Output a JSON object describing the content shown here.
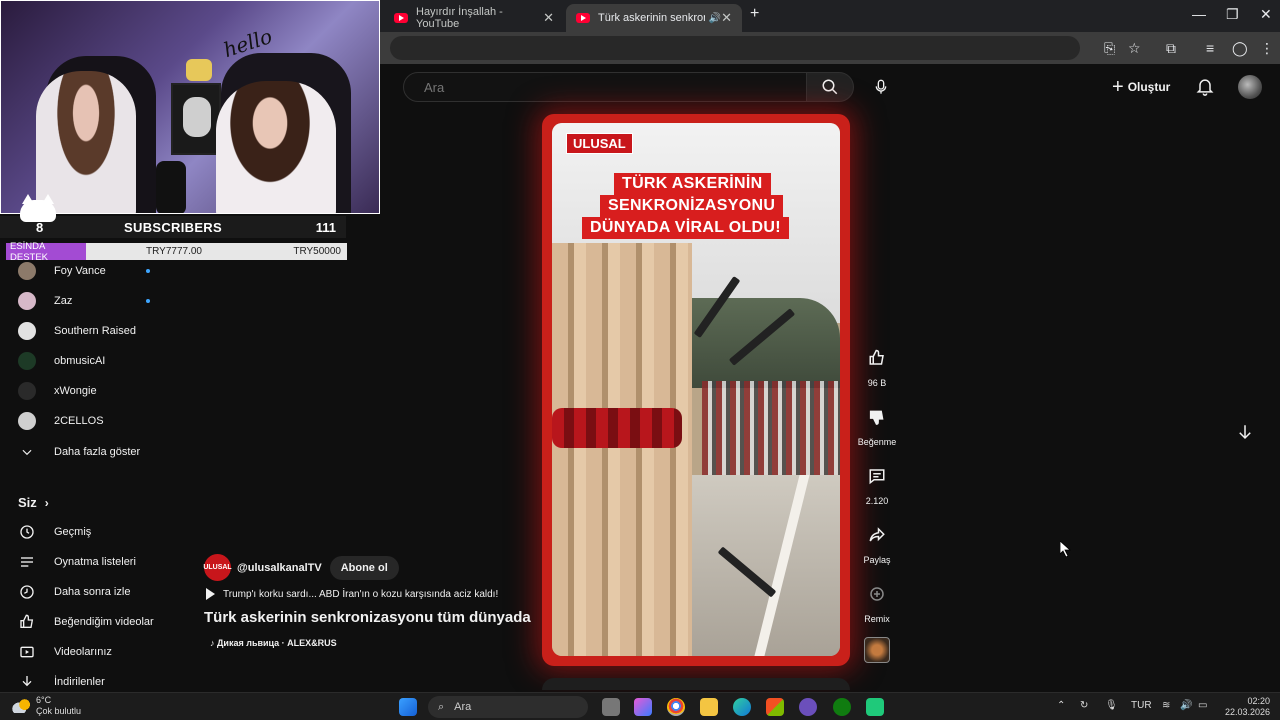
{
  "browser": {
    "tabs": [
      {
        "title": "Hayırdır İnşallah - YouTube",
        "active": false
      },
      {
        "title": "Türk askerinin senkronizasy",
        "active": true
      }
    ],
    "new_tab": "+",
    "window_controls": {
      "minimize": "—",
      "maximize": "❐",
      "close": "✕"
    }
  },
  "yt_header": {
    "search_placeholder": "Ara",
    "create_label": "Oluştur"
  },
  "stream_overlay": {
    "subscribers_left": "8",
    "subscribers_label": "SUBSCRIBERS",
    "subscribers_right": "111",
    "donation_tag": "ESİNDA DESTEK",
    "donation_amount": "TRY7777.00",
    "donation_goal": "TRY50000",
    "webcam_text": "hello"
  },
  "sidebar": {
    "subscriptions": [
      {
        "name": "Foy Vance",
        "new": true
      },
      {
        "name": "Zaz",
        "new": true
      },
      {
        "name": "Southern Raised",
        "new": false
      },
      {
        "name": "obmusicAI",
        "new": false
      },
      {
        "name": "xWongie",
        "new": false
      },
      {
        "name": "2CELLOS",
        "new": false
      }
    ],
    "show_more": "Daha fazla göster",
    "you_section": "Siz",
    "you_items": [
      {
        "label": "Geçmiş",
        "icon": "history-icon"
      },
      {
        "label": "Oynatma listeleri",
        "icon": "playlist-icon"
      },
      {
        "label": "Daha sonra izle",
        "icon": "watch-later-icon"
      },
      {
        "label": "Beğendiğim videolar",
        "icon": "like-icon"
      },
      {
        "label": "Videolarınız",
        "icon": "video-icon"
      },
      {
        "label": "İndirilenler",
        "icon": "download-icon"
      }
    ]
  },
  "short": {
    "logo_text": "ULUSAL",
    "headline": [
      "TÜRK ASKERİNİN",
      "SENKRONİZASYONU",
      "DÜNYADA VİRAL OLDU!"
    ],
    "channel_logo": "ULUSAL",
    "channel": "@ulusalkanalTV",
    "subscribe_label": "Abone ol",
    "related_video": "Trump'ı korku sardı... ABD İran'ın o kozu karşısında aciz kaldı!",
    "title": "Türk askerinin senkronizasyonu tüm dünyada ...",
    "music": "Дикая львица · ALEX&RUS"
  },
  "actions": {
    "likes": "96 B",
    "dislike": "Beğenme",
    "comments": "2.120",
    "share": "Paylaş",
    "remix": "Remix"
  },
  "taskbar": {
    "temp": "6°C",
    "weather": "Çok bulutlu",
    "search": "Ara",
    "language": "TUR",
    "time": "02:20",
    "date": "22.03.2026"
  },
  "colors": {
    "background": "#0f0f0f",
    "accent_red": "#c9201a",
    "new_dot": "#3ea6ff",
    "donation_tag": "#a34bd3"
  }
}
